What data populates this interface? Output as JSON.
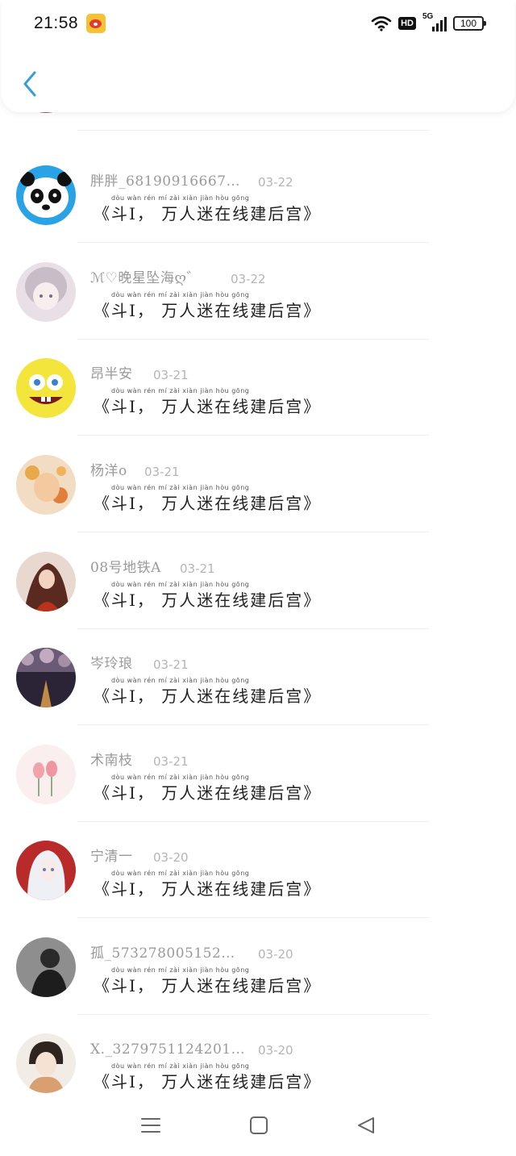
{
  "status_bar": {
    "time": "21:58",
    "hd_label": "HD",
    "network_label": "5G",
    "battery": "100"
  },
  "header": {
    "back_icon": "chevron-left-icon",
    "accent_color": "#3a9bdc"
  },
  "message_text": "《斗I， 万人迷在线建后宫》",
  "message_pinyin": "dòu       wàn  rén   mí   zài  xiàn  jiàn  hòu  gōng",
  "items": [
    {
      "name": "",
      "date": ""
    },
    {
      "name": "胖胖_68190916667…",
      "date": "03-22"
    },
    {
      "name": "ℳ♡晚星坠海ღ゛",
      "date": "03-22"
    },
    {
      "name": "昂半安",
      "date": "03-21"
    },
    {
      "name": "杨洋o",
      "date": "03-21"
    },
    {
      "name": "08号地铁A",
      "date": "03-21"
    },
    {
      "name": "岑玲琅",
      "date": "03-21"
    },
    {
      "name": "术南枝",
      "date": "03-21"
    },
    {
      "name": "宁清一",
      "date": "03-20"
    },
    {
      "name": "孤_573278005152…",
      "date": "03-20"
    },
    {
      "name": "X._3279751124201…",
      "date": "03-20"
    }
  ],
  "nav": {
    "menu_icon": "menu-icon",
    "home_icon": "home-square-icon",
    "back_icon": "back-triangle-icon"
  }
}
